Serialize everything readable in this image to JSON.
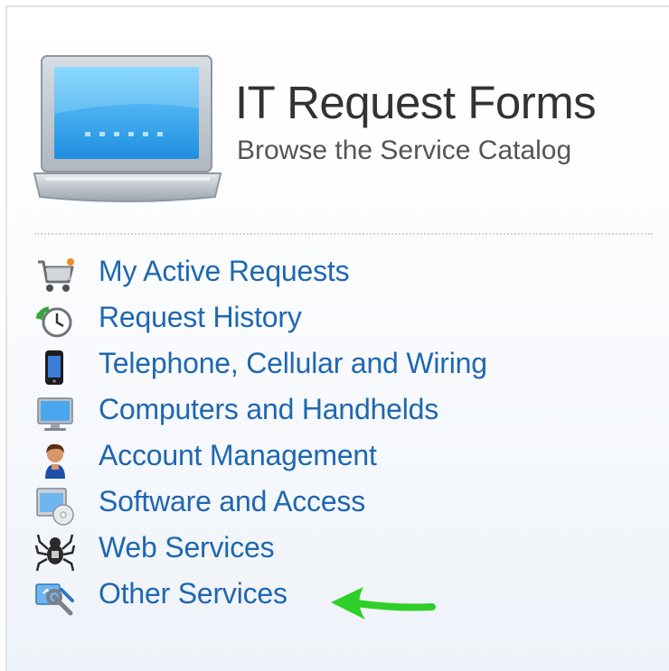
{
  "header": {
    "title": "IT Request Forms",
    "subtitle": "Browse the Service Catalog",
    "icon": "laptop-icon"
  },
  "links": [
    {
      "label": "My Active Requests",
      "icon": "shopping-cart-icon"
    },
    {
      "label": "Request History",
      "icon": "history-clock-icon"
    },
    {
      "label": "Telephone, Cellular and Wiring",
      "icon": "phone-icon"
    },
    {
      "label": "Computers and Handhelds",
      "icon": "monitor-icon"
    },
    {
      "label": "Account Management",
      "icon": "user-account-icon"
    },
    {
      "label": "Software and Access",
      "icon": "software-cd-icon"
    },
    {
      "label": "Web Services",
      "icon": "spider-icon"
    },
    {
      "label": "Other Services",
      "icon": "tools-services-icon"
    }
  ],
  "annotation": {
    "icon": "green-arrow-icon",
    "color": "#2fcf2a"
  },
  "colors": {
    "link": "#1f67b1",
    "title": "#333333",
    "subtitle": "#555555"
  }
}
